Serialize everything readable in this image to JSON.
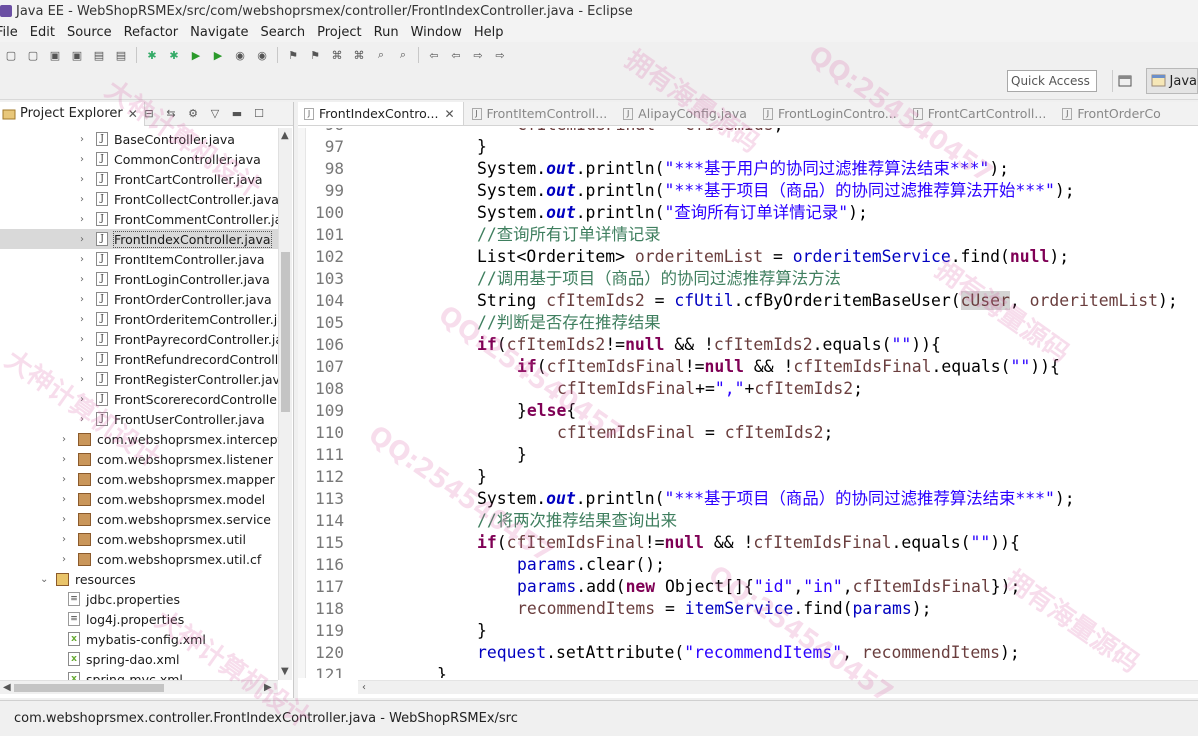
{
  "window": {
    "title": "Java EE - WebShopRSMEx/src/com/webshoprsmex/controller/FrontIndexController.java - Eclipse"
  },
  "menu": [
    "File",
    "Edit",
    "Source",
    "Refactor",
    "Navigate",
    "Search",
    "Project",
    "Run",
    "Window",
    "Help"
  ],
  "toolbar": {
    "quick_access_placeholder": "Quick Access",
    "perspective_label": "Java",
    "icons": [
      "new-icon",
      "save-icon",
      "print-icon",
      "debug-icon",
      "run-icon",
      "coverage-icon",
      "external-tools-icon",
      "open-type-icon",
      "search-icon",
      "back-icon",
      "forward-icon"
    ]
  },
  "explorer": {
    "tab_label": "Project Explorer",
    "items": [
      {
        "label": "BaseController.java",
        "kind": "java",
        "indent": 1
      },
      {
        "label": "CommonController.java",
        "kind": "java",
        "indent": 1
      },
      {
        "label": "FrontCartController.java",
        "kind": "java",
        "indent": 1
      },
      {
        "label": "FrontCollectController.java",
        "kind": "java",
        "indent": 1
      },
      {
        "label": "FrontCommentController.jav",
        "kind": "java",
        "indent": 1
      },
      {
        "label": "FrontIndexController.java",
        "kind": "java",
        "indent": 1,
        "selected": true
      },
      {
        "label": "FrontItemController.java",
        "kind": "java",
        "indent": 1
      },
      {
        "label": "FrontLoginController.java",
        "kind": "java",
        "indent": 1
      },
      {
        "label": "FrontOrderController.java",
        "kind": "java",
        "indent": 1
      },
      {
        "label": "FrontOrderitemController.ja",
        "kind": "java",
        "indent": 1
      },
      {
        "label": "FrontPayrecordController.ja",
        "kind": "java",
        "indent": 1
      },
      {
        "label": "FrontRefundrecordControlle",
        "kind": "java",
        "indent": 1
      },
      {
        "label": "FrontRegisterController.java",
        "kind": "java",
        "indent": 1
      },
      {
        "label": "FrontScorerecordController",
        "kind": "java",
        "indent": 1
      },
      {
        "label": "FrontUserController.java",
        "kind": "java",
        "indent": 1
      },
      {
        "label": "com.webshoprsmex.interceptor",
        "kind": "package",
        "indent": 0
      },
      {
        "label": "com.webshoprsmex.listener",
        "kind": "package",
        "indent": 0
      },
      {
        "label": "com.webshoprsmex.mapper",
        "kind": "package",
        "indent": 0
      },
      {
        "label": "com.webshoprsmex.model",
        "kind": "package",
        "indent": 0
      },
      {
        "label": "com.webshoprsmex.service",
        "kind": "package",
        "indent": 0
      },
      {
        "label": "com.webshoprsmex.util",
        "kind": "package",
        "indent": 0
      },
      {
        "label": "com.webshoprsmex.util.cf",
        "kind": "package",
        "indent": 0
      },
      {
        "label": "resources",
        "kind": "folder",
        "indent": -1,
        "expanded": true
      },
      {
        "label": "jdbc.properties",
        "kind": "props",
        "indent": 0
      },
      {
        "label": "log4j.properties",
        "kind": "props",
        "indent": 0
      },
      {
        "label": "mybatis-config.xml",
        "kind": "xml",
        "indent": 0
      },
      {
        "label": "spring-dao.xml",
        "kind": "xml",
        "indent": 0
      },
      {
        "label": "spring-mvc.xml",
        "kind": "xml",
        "indent": 0
      }
    ]
  },
  "editor": {
    "tabs": [
      {
        "label": "FrontIndexContro...",
        "active": true
      },
      {
        "label": "FrontItemControll...",
        "active": false
      },
      {
        "label": "AlipayConfig.java",
        "active": false
      },
      {
        "label": "FrontLoginContro...",
        "active": false
      },
      {
        "label": "FrontCartControll...",
        "active": false
      },
      {
        "label": "FrontOrderCo",
        "active": false
      }
    ],
    "first_line_partial": "96",
    "lines": [
      {
        "n": "96",
        "html": "<span class=\"var\">cfItemIdsFinal</span> = <span class=\"var\">cfItemIds</span>;",
        "indent": 5
      },
      {
        "n": "97",
        "html": "}",
        "indent": 4
      },
      {
        "n": "98",
        "html": "System.<span class=\"fld\">out</span>.println(<span class=\"str\">\"***基于用户的协同过滤推荐算法结束***\"</span>);",
        "indent": 4
      },
      {
        "n": "99",
        "html": "System.<span class=\"fld\">out</span>.println(<span class=\"str\">\"***基于项目（商品）的协同过滤推荐算法开始***\"</span>);",
        "indent": 4
      },
      {
        "n": "100",
        "html": "System.<span class=\"fld\">out</span>.println(<span class=\"str\">\"查询所有订单详情记录\"</span>);",
        "indent": 4
      },
      {
        "n": "101",
        "html": "<span class=\"cm\">//查询所有订单详情记录</span>",
        "indent": 4
      },
      {
        "n": "102",
        "html": "List&lt;Orderitem&gt; <span class=\"var\">orderitemList</span> = <span class=\"str\" style=\"color:#0000c0\">orderitemService</span>.find(<span class=\"kw\">null</span>);",
        "indent": 4
      },
      {
        "n": "103",
        "html": "<span class=\"cm\">//调用基于项目（商品）的协同过滤推荐算法方法</span>",
        "indent": 4
      },
      {
        "n": "104",
        "html": "String <span class=\"var\">cfItemIds2</span> = <span class=\"str\" style=\"color:#0000c0\">cfUtil</span>.cfByOrderitemBaseUser(<span class=\"var mark\">cUser</span>, <span class=\"var\">orderitemList</span>);",
        "indent": 4
      },
      {
        "n": "105",
        "html": "<span class=\"cm\">//判断是否存在推荐结果</span>",
        "indent": 4
      },
      {
        "n": "106",
        "html": "<span class=\"kw\">if</span>(<span class=\"var\">cfItemIds2</span>!=<span class=\"kw\">null</span> &amp;&amp; !<span class=\"var\">cfItemIds2</span>.equals(<span class=\"str\">\"\"</span>)){",
        "indent": 4
      },
      {
        "n": "107",
        "html": "<span class=\"kw\">if</span>(<span class=\"var\">cfItemIdsFinal</span>!=<span class=\"kw\">null</span> &amp;&amp; !<span class=\"var\">cfItemIdsFinal</span>.equals(<span class=\"str\">\"\"</span>)){",
        "indent": 5
      },
      {
        "n": "108",
        "html": "<span class=\"var\">cfItemIdsFinal</span>+=<span class=\"str\">\",\"</span>+<span class=\"var\">cfItemIds2</span>;",
        "indent": 6
      },
      {
        "n": "109",
        "html": "}<span class=\"kw\">else</span>{",
        "indent": 5
      },
      {
        "n": "110",
        "html": "<span class=\"var\">cfItemIdsFinal</span> = <span class=\"var\">cfItemIds2</span>;",
        "indent": 6
      },
      {
        "n": "111",
        "html": "}",
        "indent": 5
      },
      {
        "n": "112",
        "html": "}",
        "indent": 4
      },
      {
        "n": "113",
        "html": "System.<span class=\"fld\">out</span>.println(<span class=\"str\">\"***基于项目（商品）的协同过滤推荐算法结束***\"</span>);",
        "indent": 4
      },
      {
        "n": "114",
        "html": "<span class=\"cm\">//将两次推荐结果查询出来</span>",
        "indent": 4
      },
      {
        "n": "115",
        "html": "<span class=\"kw\">if</span>(<span class=\"var\">cfItemIdsFinal</span>!=<span class=\"kw\">null</span> &amp;&amp; !<span class=\"var\">cfItemIdsFinal</span>.equals(<span class=\"str\">\"\"</span>)){",
        "indent": 4
      },
      {
        "n": "116",
        "html": "<span class=\"str\" style=\"color:#0000c0\">params</span>.clear();",
        "indent": 5
      },
      {
        "n": "117",
        "html": "<span class=\"str\" style=\"color:#0000c0\">params</span>.add(<span class=\"kw\">new</span> Object[]{<span class=\"str\">\"id\"</span>,<span class=\"str\">\"in\"</span>,<span class=\"var\">cfItemIdsFinal</span>});",
        "indent": 5
      },
      {
        "n": "118",
        "html": "<span class=\"var\">recommendItems</span> = <span class=\"str\" style=\"color:#0000c0\">itemService</span>.find(<span class=\"str\" style=\"color:#0000c0\">params</span>);",
        "indent": 5
      },
      {
        "n": "119",
        "html": "}",
        "indent": 4
      },
      {
        "n": "120",
        "html": "<span class=\"str\" style=\"color:#0000c0\">request</span>.setAttribute(<span class=\"str\">\"recommendItems\"</span>, <span class=\"var\">recommendItems</span>);",
        "indent": 4
      },
      {
        "n": "121",
        "html": "}",
        "indent": 3
      }
    ]
  },
  "statusbar": {
    "text": "com.webshoprsmex.controller.FrontIndexController.java - WebShopRSMEx/src"
  },
  "watermarks": [
    "QQ:254540457",
    "大神计算机设计",
    "拥有海量源码"
  ]
}
